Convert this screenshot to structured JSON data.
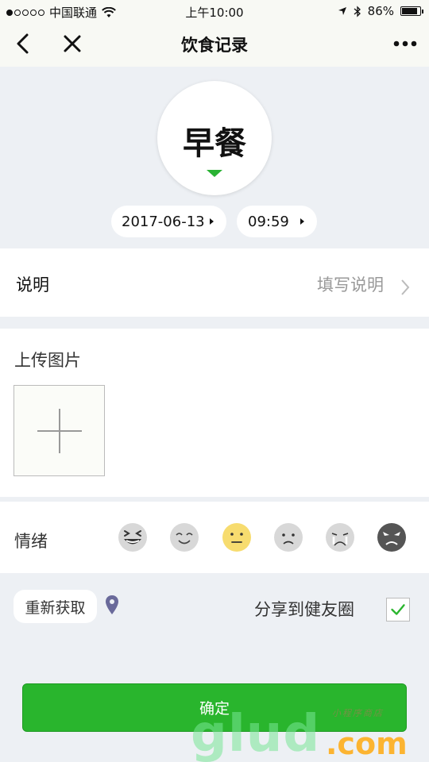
{
  "status_bar": {
    "carrier": "中国联通",
    "time": "上午10:00",
    "battery": "86%"
  },
  "nav": {
    "title": "饮食记录"
  },
  "meal": {
    "type": "早餐",
    "date": "2017-06-13",
    "time": "09:59",
    "accent_color": "#2ab234"
  },
  "description": {
    "label": "说明",
    "placeholder": "填写说明"
  },
  "upload": {
    "label": "上传图片"
  },
  "mood": {
    "label": "情绪",
    "options": [
      "laughing-face-icon",
      "smiling-face-icon",
      "neutral-face-icon",
      "sad-face-icon",
      "crying-face-icon",
      "angry-face-icon"
    ],
    "selected": "neutral-face-icon"
  },
  "location": {
    "refresh_label": "重新获取"
  },
  "share": {
    "label": "分享到健友圈",
    "checked": true
  },
  "confirm": {
    "label": "确定",
    "color": "#29b52d"
  },
  "watermark": {
    "brand": "glud",
    "domain": ".com",
    "tagline": "小程序商店"
  }
}
